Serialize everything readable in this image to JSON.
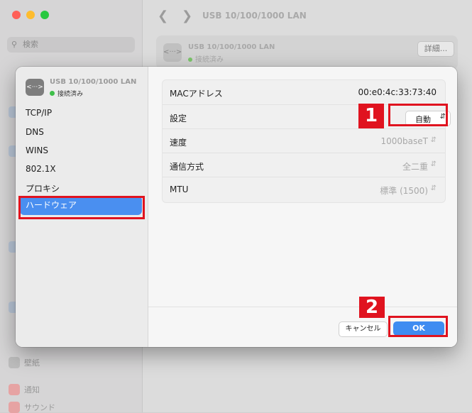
{
  "background": {
    "search_placeholder": "検索",
    "window_title": "USB 10/100/1000 LAN",
    "card_name": "USB 10/100/1000 LAN",
    "card_status": "接続済み",
    "details_button": "詳細...",
    "sidebar_items": [
      {
        "label": "壁紙"
      },
      {
        "label": "通知"
      },
      {
        "label": "サウンド"
      }
    ]
  },
  "dialog": {
    "interface": {
      "name": "USB 10/100/1000 LAN",
      "status": "接続済み"
    },
    "sidebar": [
      {
        "label": "TCP/IP"
      },
      {
        "label": "DNS"
      },
      {
        "label": "WINS"
      },
      {
        "label": "802.1X"
      },
      {
        "label": "プロキシ"
      }
    ],
    "selected_item": "ハードウェア",
    "rows": [
      {
        "label": "MACアドレス",
        "value": "00:e0:4c:33:73:40"
      },
      {
        "label": "設定",
        "value": "自動"
      },
      {
        "label": "速度",
        "value": "1000baseT"
      },
      {
        "label": "通信方式",
        "value": "全二重"
      },
      {
        "label": "MTU",
        "value": "標準 (1500)"
      }
    ],
    "cancel_button": "キャンセル",
    "ok_button": "OK"
  },
  "annotations": {
    "step1": "1",
    "step2": "2",
    "color": "#e0131f"
  },
  "colors": {
    "accent": "#3f8cf1",
    "selection": "#4a8ff0",
    "connected": "#3fbf4a"
  }
}
